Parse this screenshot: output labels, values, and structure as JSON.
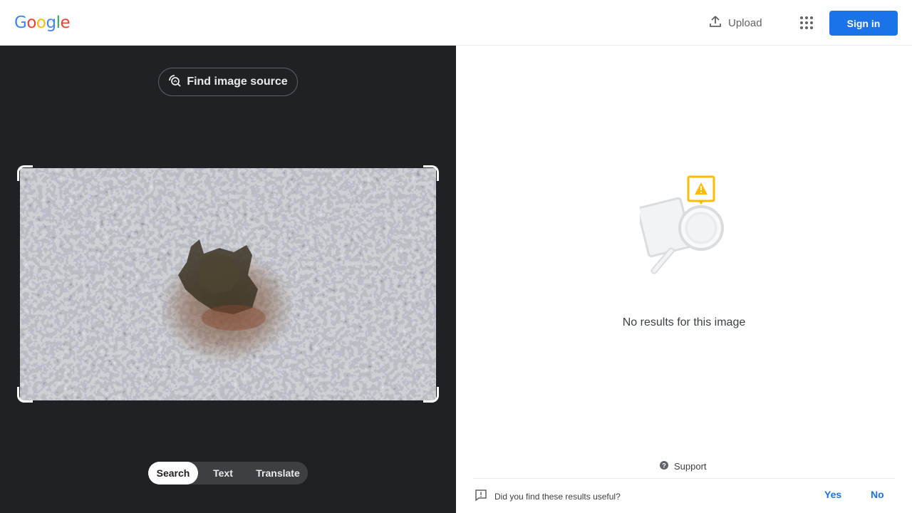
{
  "header": {
    "logo_letters": [
      {
        "ch": "G",
        "color": "#4285f4"
      },
      {
        "ch": "o",
        "color": "#ea4335"
      },
      {
        "ch": "o",
        "color": "#fbbc05"
      },
      {
        "ch": "g",
        "color": "#4285f4"
      },
      {
        "ch": "l",
        "color": "#34a853"
      },
      {
        "ch": "e",
        "color": "#ea4335"
      }
    ],
    "upload_label": "Upload",
    "upload_icon": "upload-icon",
    "apps_icon": "apps-grid-icon",
    "signin_label": "Sign in"
  },
  "lens": {
    "find_source_label": "Find image source",
    "find_source_icon": "image-search-icon",
    "modes": [
      {
        "label": "Search",
        "active": true
      },
      {
        "label": "Text",
        "active": false
      },
      {
        "label": "Translate",
        "active": false
      }
    ]
  },
  "results": {
    "illustration_icon": "no-results-illustration",
    "message": "No results for this image",
    "support_label": "Support",
    "support_icon": "help-icon",
    "feedback_question": "Did you find these results useful?",
    "feedback_icon": "feedback-icon",
    "yes_label": "Yes",
    "no_label": "No"
  },
  "colors": {
    "accent": "#1a73e8",
    "dark_panel": "#202124",
    "warning": "#fbbc04"
  }
}
